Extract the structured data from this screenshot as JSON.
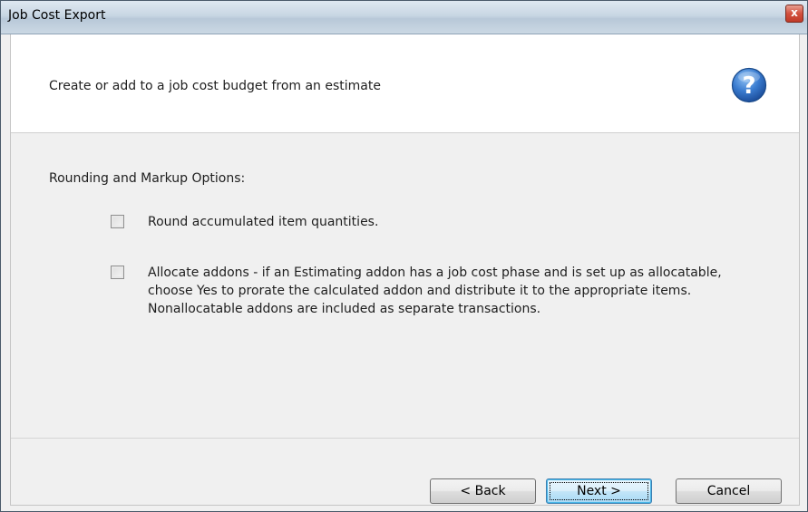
{
  "window": {
    "title": "Job Cost Export",
    "close_glyph": "x"
  },
  "header": {
    "text": "Create or add to a job cost budget from an estimate",
    "help_icon": "help-question-icon"
  },
  "section": {
    "title": "Rounding and Markup Options:"
  },
  "options": [
    {
      "label": "Round accumulated item quantities.",
      "checked": false
    },
    {
      "label": "Allocate addons - if an Estimating addon has a job cost phase and is set up as allocatable, choose Yes to prorate the calculated addon and distribute it to the appropriate items.  Nonallocatable addons are included as separate transactions.",
      "checked": false
    }
  ],
  "buttons": {
    "back": "< Back",
    "next": "Next >",
    "cancel": "Cancel"
  },
  "colors": {
    "help_icon": "#2f6fc0",
    "next_border": "#3c7fb1"
  }
}
